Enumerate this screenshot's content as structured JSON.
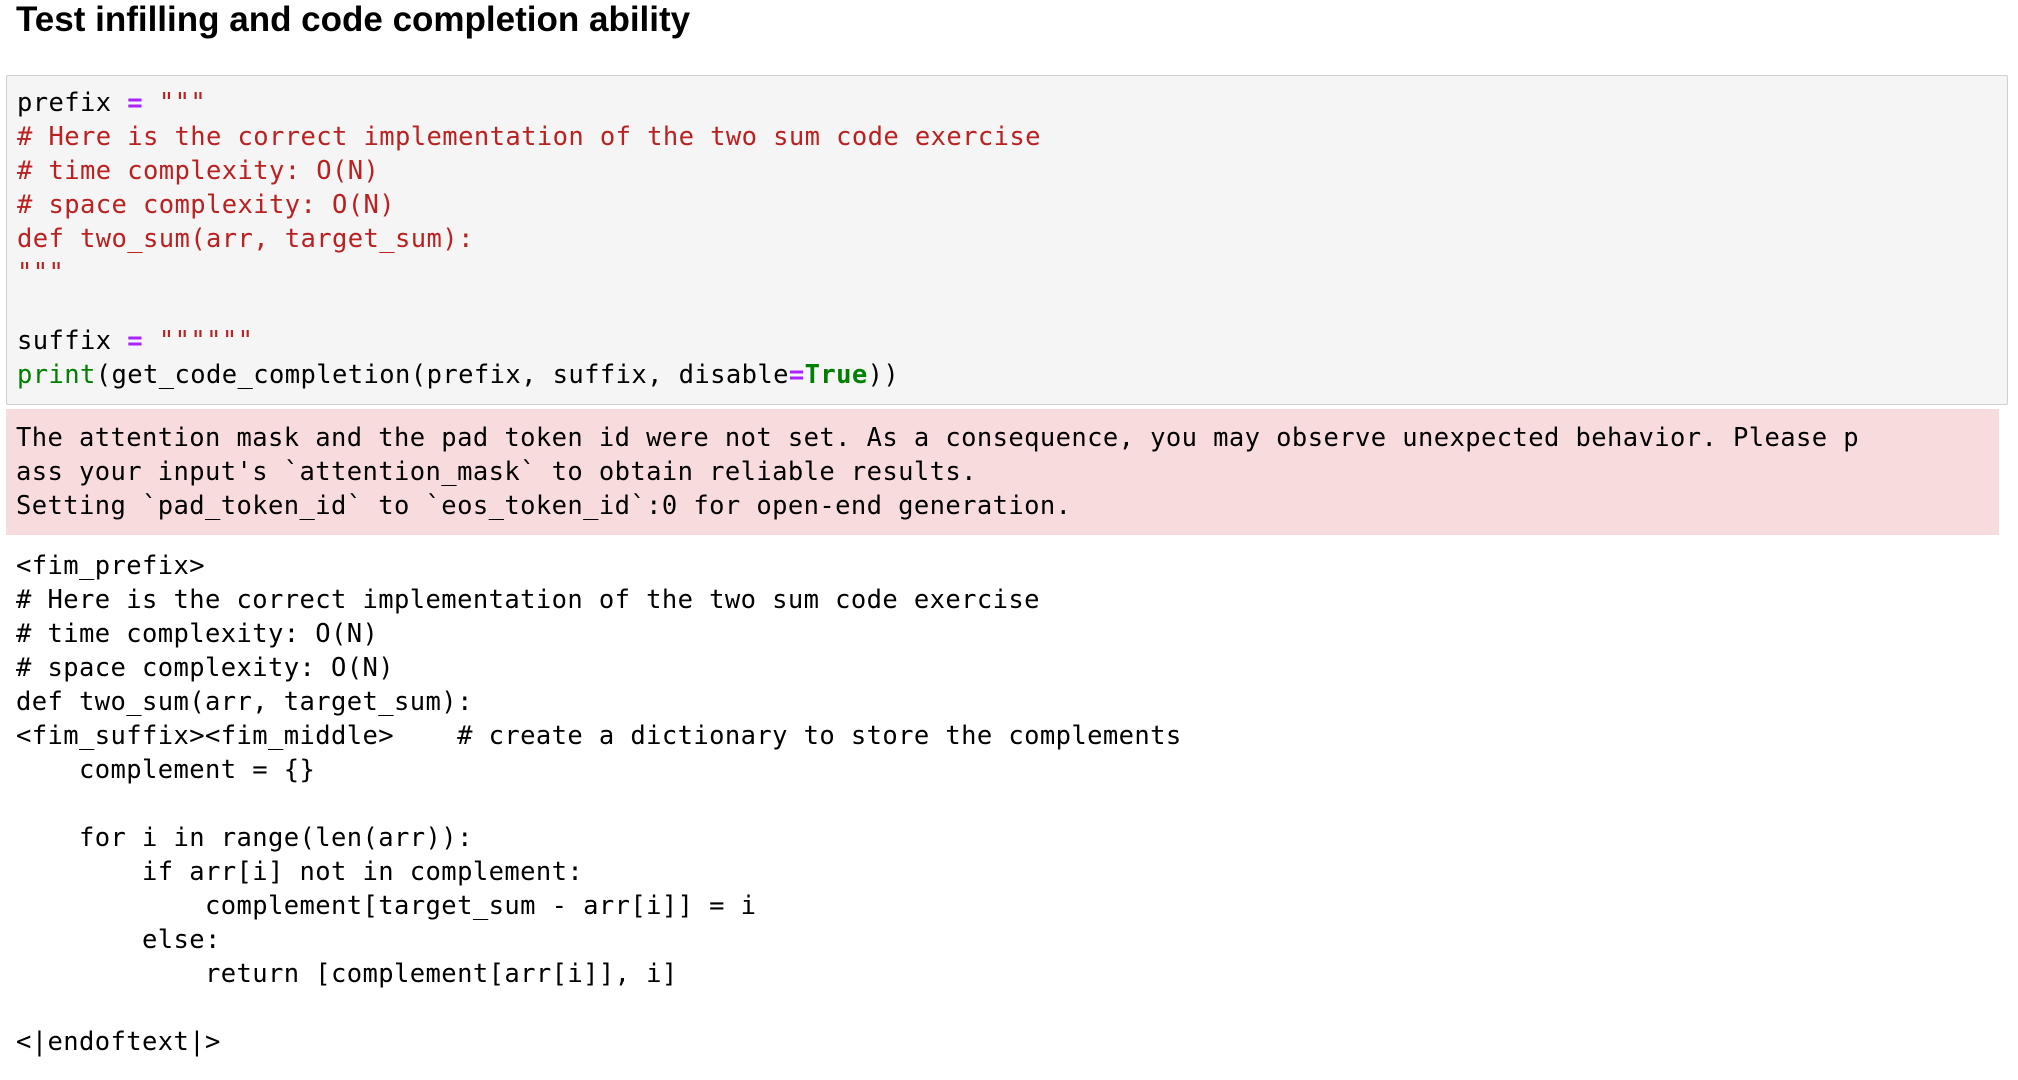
{
  "heading": "Test infilling and code completion ability",
  "input": {
    "prefix_var": "prefix",
    "op": "=",
    "prefix_open": "\"\"\"",
    "prefix_lines": [
      "# Here is the correct implementation of the two sum code exercise",
      "# time complexity: O(N)",
      "# space complexity: O(N)",
      "def two_sum(arr, target_sum):",
      "\"\"\""
    ],
    "suffix_var": "suffix",
    "suffix_value": "\"\"\"\"\"\"",
    "print_fn": "print",
    "call_open": "(get_code_completion(prefix, suffix, disable",
    "eq": "=",
    "true_kw": "True",
    "call_close": "))"
  },
  "stderr": {
    "lines": [
      "The attention mask and the pad token id were not set. As a consequence, you may observe unexpected behavior. Please p",
      "ass your input's `attention_mask` to obtain reliable results.",
      "Setting `pad_token_id` to `eos_token_id`:0 for open-end generation."
    ]
  },
  "stdout": {
    "lines": [
      "<fim_prefix>",
      "# Here is the correct implementation of the two sum code exercise",
      "# time complexity: O(N)",
      "# space complexity: O(N)",
      "def two_sum(arr, target_sum):",
      "<fim_suffix><fim_middle>    # create a dictionary to store the complements",
      "    complement = {}",
      "",
      "    for i in range(len(arr)):",
      "        if arr[i] not in complement:",
      "            complement[target_sum - arr[i]] = i",
      "        else:",
      "            return [complement[arr[i]], i]",
      "",
      "<|endoftext|>"
    ]
  }
}
